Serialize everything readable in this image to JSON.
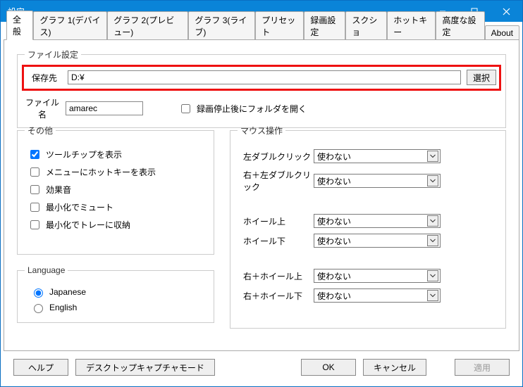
{
  "window": {
    "title": "設定"
  },
  "tabs": {
    "items": [
      "全般",
      "グラフ 1(デバイス)",
      "グラフ 2(プレビュー)",
      "グラフ 3(ライブ)",
      "プリセット",
      "録画設定",
      "スクショ",
      "ホットキー",
      "高度な設定",
      "About"
    ],
    "active": 0
  },
  "file_settings": {
    "legend": "ファイル設定",
    "save_label": "保存先",
    "save_path": "D:¥",
    "browse_label": "選択",
    "filename_label": "ファイル名",
    "filename_value": "amarec",
    "open_after_stop_label": "録画停止後にフォルダを開く",
    "open_after_stop_checked": false
  },
  "other": {
    "legend": "その他",
    "items": [
      {
        "label": "ツールチップを表示",
        "checked": true
      },
      {
        "label": "メニューにホットキーを表示",
        "checked": false
      },
      {
        "label": "効果音",
        "checked": false
      },
      {
        "label": "最小化でミュート",
        "checked": false
      },
      {
        "label": "最小化でトレーに収納",
        "checked": false
      }
    ]
  },
  "language": {
    "legend": "Language",
    "options": [
      {
        "label": "Japanese",
        "selected": true
      },
      {
        "label": "English",
        "selected": false
      }
    ]
  },
  "mouse": {
    "legend": "マウス操作",
    "rows": [
      {
        "label": "左ダブルクリック",
        "value": "使わない"
      },
      {
        "label": "右＋左ダブルクリック",
        "value": "使わない"
      },
      {
        "label": "ホイール上",
        "value": "使わない"
      },
      {
        "label": "ホイール下",
        "value": "使わない"
      },
      {
        "label": "右＋ホイール上",
        "value": "使わない"
      },
      {
        "label": "右＋ホイール下",
        "value": "使わない"
      }
    ]
  },
  "footer": {
    "help": "ヘルプ",
    "desktop_mode": "デスクトップキャプチャモード",
    "ok": "OK",
    "cancel": "キャンセル",
    "apply": "適用"
  }
}
